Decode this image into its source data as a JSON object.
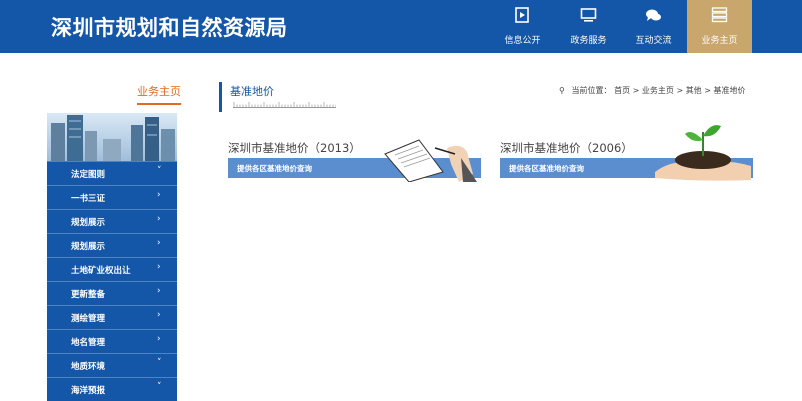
{
  "header": {
    "site_title": "深圳市规划和自然资源局",
    "nav": [
      {
        "label": "信息公开",
        "icon": "document-icon"
      },
      {
        "label": "政务服务",
        "icon": "monitor-icon"
      },
      {
        "label": "互动交流",
        "icon": "chat-bubble-icon"
      },
      {
        "label": "业务主页",
        "icon": "server-stack-icon",
        "active": true
      }
    ],
    "colors": {
      "bar": "#1456a8",
      "active": "#c9a76c"
    }
  },
  "sidebar": {
    "heading": "业务主页",
    "items": [
      {
        "label": "法定图则",
        "chevron": "˅"
      },
      {
        "label": "一书三证",
        "chevron": "›"
      },
      {
        "label": "规划展示",
        "chevron": "›"
      },
      {
        "label": "规划展示",
        "chevron": "›"
      },
      {
        "label": "土地矿业权出让",
        "chevron": "›"
      },
      {
        "label": "更新整备",
        "chevron": "›"
      },
      {
        "label": "测绘管理",
        "chevron": "›"
      },
      {
        "label": "地名管理",
        "chevron": "›"
      },
      {
        "label": "地质环境",
        "chevron": "˅"
      },
      {
        "label": "海洋预报",
        "chevron": "˅"
      }
    ]
  },
  "main": {
    "title": "基准地价",
    "breadcrumb": {
      "prefix": "当前位置：",
      "items": [
        "首页",
        "业务主页",
        "其他",
        "基准地价"
      ],
      "separator": " > "
    },
    "cards": [
      {
        "title": "深圳市基准地价（2013）",
        "subtitle": "提供各区基准地价查询"
      },
      {
        "title": "深圳市基准地价（2006）",
        "subtitle": "提供各区基准地价查询"
      }
    ]
  }
}
